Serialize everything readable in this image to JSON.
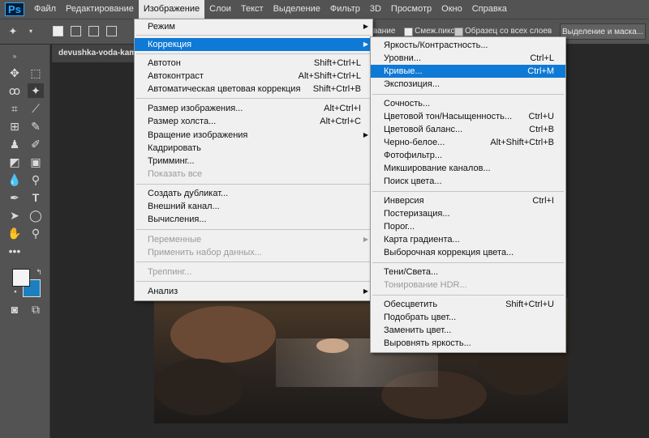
{
  "app": {
    "logo": "Ps"
  },
  "menubar": {
    "items": [
      "Файл",
      "Редактирование",
      "Изображение",
      "Слои",
      "Текст",
      "Выделение",
      "Фильтр",
      "3D",
      "Просмотр",
      "Окно",
      "Справка"
    ],
    "active_index": 2
  },
  "options": {
    "antialias_label": "вание",
    "contiguous_label": "Смеж.пикс",
    "sample_all_label": "Образец со всех слоев",
    "select_mask_label": "Выделение и маска..."
  },
  "document_tab": {
    "name": "devushka-voda-kamn"
  },
  "image_menu": {
    "items": [
      {
        "label": "Режим",
        "shortcut": "",
        "submenu": true,
        "disabled": false
      },
      {
        "label": "Коррекция",
        "shortcut": "",
        "submenu": true,
        "disabled": false,
        "highlighted": true
      },
      {
        "label": "Автотон",
        "shortcut": "Shift+Ctrl+L",
        "disabled": false
      },
      {
        "label": "Автоконтраст",
        "shortcut": "Alt+Shift+Ctrl+L",
        "disabled": false
      },
      {
        "label": "Автоматическая цветовая коррекция",
        "shortcut": "Shift+Ctrl+B",
        "disabled": false
      },
      {
        "label": "Размер изображения...",
        "shortcut": "Alt+Ctrl+I",
        "disabled": false
      },
      {
        "label": "Размер холста...",
        "shortcut": "Alt+Ctrl+C",
        "disabled": false
      },
      {
        "label": "Вращение изображения",
        "shortcut": "",
        "submenu": true,
        "disabled": false
      },
      {
        "label": "Кадрировать",
        "shortcut": "",
        "disabled": false
      },
      {
        "label": "Тримминг...",
        "shortcut": "",
        "disabled": false
      },
      {
        "label": "Показать все",
        "shortcut": "",
        "disabled": true
      },
      {
        "label": "Создать дубликат...",
        "shortcut": "",
        "disabled": false
      },
      {
        "label": "Внешний канал...",
        "shortcut": "",
        "disabled": false
      },
      {
        "label": "Вычисления...",
        "shortcut": "",
        "disabled": false
      },
      {
        "label": "Переменные",
        "shortcut": "",
        "submenu": true,
        "disabled": true
      },
      {
        "label": "Применить набор данных...",
        "shortcut": "",
        "disabled": true
      },
      {
        "label": "Треппинг...",
        "shortcut": "",
        "disabled": true
      },
      {
        "label": "Анализ",
        "shortcut": "",
        "submenu": true,
        "disabled": false
      }
    ]
  },
  "correction_menu": {
    "items": [
      {
        "label": "Яркость/Контрастность...",
        "shortcut": ""
      },
      {
        "label": "Уровни...",
        "shortcut": "Ctrl+L"
      },
      {
        "label": "Кривые...",
        "shortcut": "Ctrl+M",
        "highlighted": true
      },
      {
        "label": "Экспозиция...",
        "shortcut": ""
      },
      {
        "label": "Сочность...",
        "shortcut": ""
      },
      {
        "label": "Цветовой тон/Насыщенность...",
        "shortcut": "Ctrl+U"
      },
      {
        "label": "Цветовой баланс...",
        "shortcut": "Ctrl+B"
      },
      {
        "label": "Черно-белое...",
        "shortcut": "Alt+Shift+Ctrl+B"
      },
      {
        "label": "Фотофильтр...",
        "shortcut": ""
      },
      {
        "label": "Микширование каналов...",
        "shortcut": ""
      },
      {
        "label": "Поиск цвета...",
        "shortcut": ""
      },
      {
        "label": "Инверсия",
        "shortcut": "Ctrl+I"
      },
      {
        "label": "Постеризация...",
        "shortcut": ""
      },
      {
        "label": "Порог...",
        "shortcut": ""
      },
      {
        "label": "Карта градиента...",
        "shortcut": ""
      },
      {
        "label": "Выборочная коррекция цвета...",
        "shortcut": ""
      },
      {
        "label": "Тени/Света...",
        "shortcut": ""
      },
      {
        "label": "Тонирование HDR...",
        "shortcut": "",
        "disabled": true
      },
      {
        "label": "Обесцветить",
        "shortcut": "Shift+Ctrl+U"
      },
      {
        "label": "Подобрать цвет...",
        "shortcut": ""
      },
      {
        "label": "Заменить цвет...",
        "shortcut": ""
      },
      {
        "label": "Выровнять яркость...",
        "shortcut": ""
      }
    ]
  },
  "colors": {
    "highlight": "#0f79d6",
    "background_swatch": "#1e7fc0",
    "foreground_swatch": "#f4f4f4"
  },
  "tool_icons": [
    "move-icon",
    "marquee-icon",
    "lasso-icon",
    "magic-wand-icon",
    "crop-icon",
    "eyedropper-icon",
    "healing-icon",
    "brush-icon",
    "stamp-icon",
    "history-brush-icon",
    "eraser-icon",
    "gradient-icon",
    "blur-icon",
    "dodge-icon",
    "pen-icon",
    "type-icon",
    "path-select-icon",
    "shape-icon",
    "hand-icon",
    "zoom-icon",
    "more-icon"
  ]
}
